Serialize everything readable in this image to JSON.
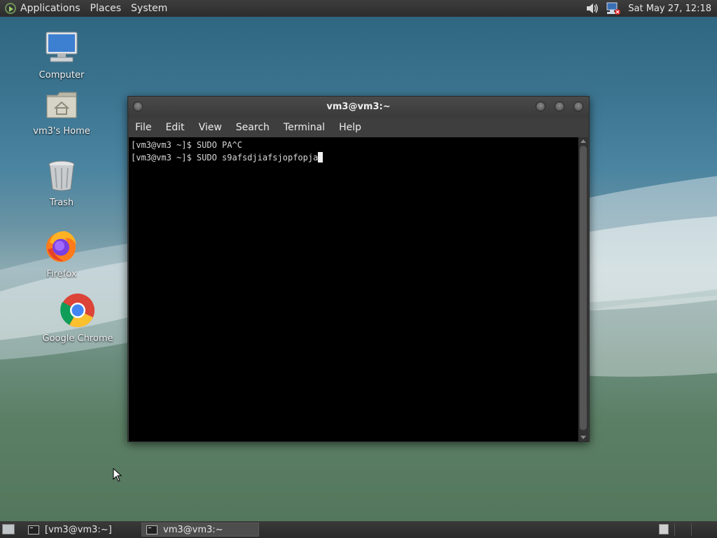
{
  "top_panel": {
    "menus": [
      "Applications",
      "Places",
      "System"
    ],
    "clock": "Sat May 27, 12:18",
    "icons": [
      "volume-icon",
      "network-icon"
    ]
  },
  "desktop": {
    "icons": [
      {
        "label": "Computer",
        "icon": "computer-icon"
      },
      {
        "label": "vm3's Home",
        "icon": "home-folder-icon"
      },
      {
        "label": "Trash",
        "icon": "trash-icon"
      },
      {
        "label": "Firefox",
        "icon": "firefox-icon"
      },
      {
        "label": "Google Chrome",
        "icon": "chrome-icon"
      }
    ]
  },
  "terminal": {
    "title": "vm3@vm3:~",
    "menu": [
      "File",
      "Edit",
      "View",
      "Search",
      "Terminal",
      "Help"
    ],
    "lines": [
      "[vm3@vm3 ~]$ SUDO PA^C",
      "[vm3@vm3 ~]$ SUDO s9afsdjiafsjopfopja"
    ]
  },
  "bottom_panel": {
    "tasks": [
      {
        "label": "[vm3@vm3:~]",
        "active": false
      },
      {
        "label": "vm3@vm3:~",
        "active": true
      }
    ]
  },
  "colors": {
    "terminal_bg": "#000000",
    "panel_bg": "#2c2c2c"
  }
}
